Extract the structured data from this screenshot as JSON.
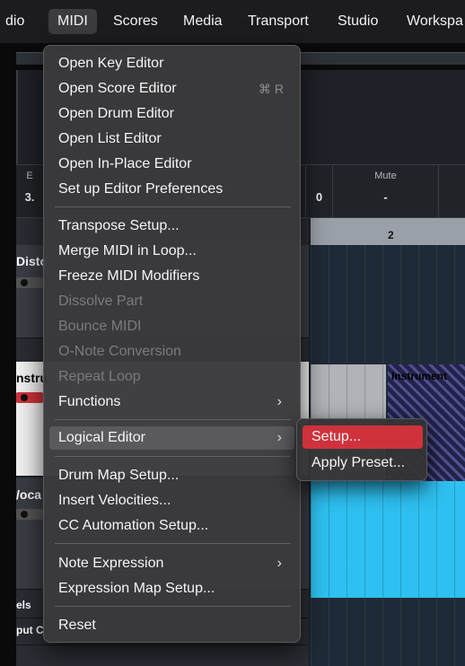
{
  "menubar": {
    "items": [
      {
        "label": "dio"
      },
      {
        "label": "MIDI",
        "active": true
      },
      {
        "label": "Scores"
      },
      {
        "label": "Media"
      },
      {
        "label": "Transport"
      },
      {
        "label": "Studio"
      },
      {
        "label": "Workspa"
      }
    ]
  },
  "info_line": {
    "cell1_label": "E",
    "cell1_value": "3.",
    "cell2_value": "0",
    "mute_label": "Mute",
    "mute_value": "-"
  },
  "tracks": [
    {
      "name": "Disto"
    },
    {
      "name": "nstru"
    },
    {
      "name": "/oca"
    }
  ],
  "bottom_labels": {
    "label1": "els",
    "label2": "put C"
  },
  "ruler": {
    "bar_label": "2"
  },
  "parts": {
    "instrument_label": "Instrument"
  },
  "midi_menu": {
    "items": [
      {
        "label": "Open Key Editor"
      },
      {
        "label": "Open Score Editor",
        "shortcut": "⌘ R"
      },
      {
        "label": "Open Drum Editor"
      },
      {
        "label": "Open List Editor"
      },
      {
        "label": "Open In-Place Editor"
      },
      {
        "label": "Set up Editor Preferences"
      },
      {
        "label": "Transpose Setup..."
      },
      {
        "label": "Merge MIDI in Loop..."
      },
      {
        "label": "Freeze MIDI Modifiers"
      },
      {
        "label": "Dissolve Part",
        "disabled": true
      },
      {
        "label": "Bounce MIDI",
        "disabled": true
      },
      {
        "label": "O-Note Conversion",
        "disabled": true
      },
      {
        "label": "Repeat Loop",
        "disabled": true
      },
      {
        "label": "Functions",
        "submenu": true
      },
      {
        "label": "Logical Editor",
        "submenu": true,
        "active": true
      },
      {
        "label": "Drum Map Setup..."
      },
      {
        "label": "Insert Velocities..."
      },
      {
        "label": "CC Automation Setup..."
      },
      {
        "label": "Note Expression",
        "submenu": true
      },
      {
        "label": "Expression Map Setup..."
      },
      {
        "label": "Reset"
      }
    ]
  },
  "sub_menu": {
    "items": [
      {
        "label": "Setup...",
        "highlighted": true
      },
      {
        "label": "Apply Preset..."
      }
    ]
  },
  "icons": {
    "chevron": "chevron-right-icon"
  },
  "colors": {
    "highlight": "#d0323c",
    "menu_bg": "#3a3a3c",
    "part_cyan": "#2ec0f0"
  }
}
